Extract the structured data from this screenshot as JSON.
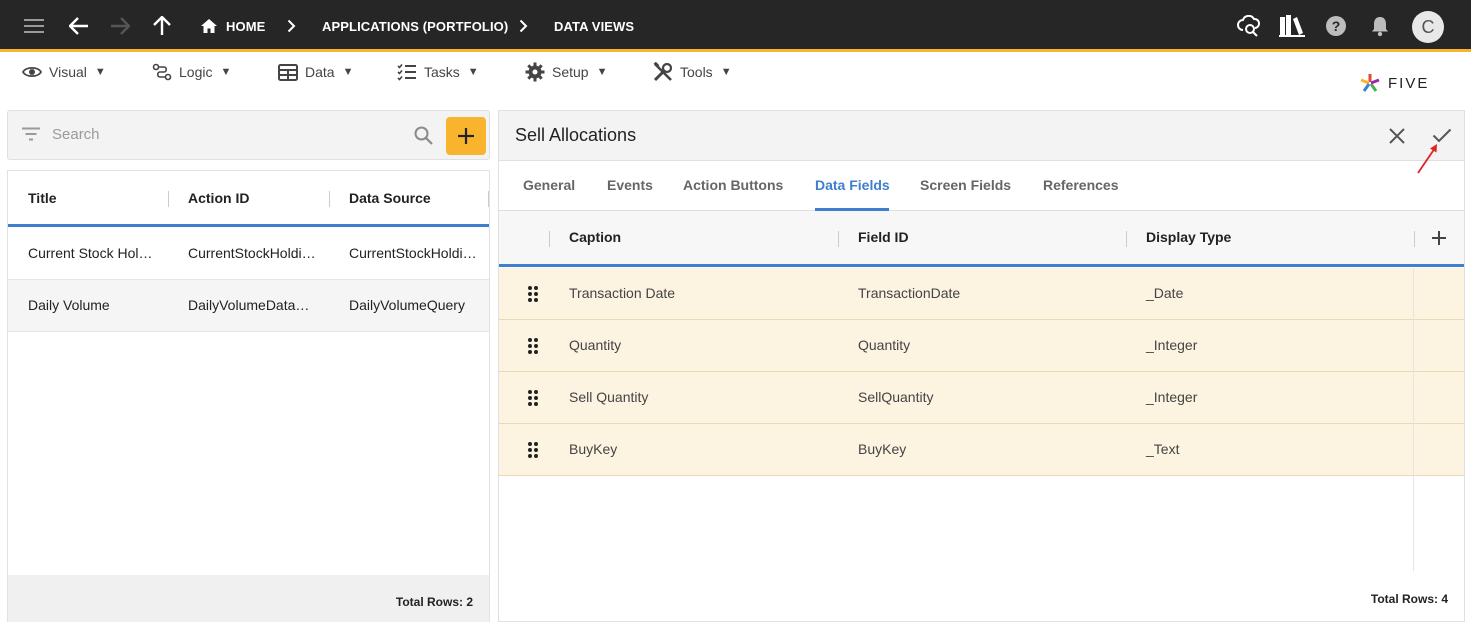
{
  "topbar": {
    "breadcrumbs": [
      {
        "label": "HOME"
      },
      {
        "label": "APPLICATIONS (PORTFOLIO)"
      },
      {
        "label": "DATA VIEWS"
      }
    ],
    "avatar_letter": "C"
  },
  "menu": {
    "items": [
      {
        "label": "Visual",
        "icon": "eye-icon"
      },
      {
        "label": "Logic",
        "icon": "logic-icon"
      },
      {
        "label": "Data",
        "icon": "table-icon"
      },
      {
        "label": "Tasks",
        "icon": "checklist-icon"
      },
      {
        "label": "Setup",
        "icon": "gear-icon"
      },
      {
        "label": "Tools",
        "icon": "tools-icon"
      }
    ],
    "caret": "▼"
  },
  "logo": {
    "text": "FIVE"
  },
  "left_panel": {
    "search_placeholder": "Search",
    "columns": [
      "Title",
      "Action ID",
      "Data Source"
    ],
    "rows": [
      [
        "Current Stock Holdings",
        "CurrentStockHoldings",
        "CurrentStockHoldings"
      ],
      [
        "Daily Volume",
        "DailyVolumeDataView",
        "DailyVolumeQuery"
      ]
    ],
    "footer": "Total Rows: 2"
  },
  "right_panel": {
    "title": "Sell Allocations",
    "tabs": [
      "General",
      "Events",
      "Action Buttons",
      "Data Fields",
      "Screen Fields",
      "References"
    ],
    "active_tab": "Data Fields",
    "columns": [
      "Caption",
      "Field ID",
      "Display Type"
    ],
    "rows": [
      [
        "Transaction Date",
        "TransactionDate",
        "_Date"
      ],
      [
        "Quantity",
        "Quantity",
        "_Integer"
      ],
      [
        "Sell Quantity",
        "SellQuantity",
        "_Integer"
      ],
      [
        "BuyKey",
        "BuyKey",
        "_Text"
      ]
    ],
    "footer": "Total Rows: 4"
  },
  "colors": {
    "topbar": "#262626",
    "accent": "#f7b42c",
    "active": "#3f7fce",
    "row_highlight": "#fdf3e1",
    "annotation_arrow": "#e02424"
  }
}
